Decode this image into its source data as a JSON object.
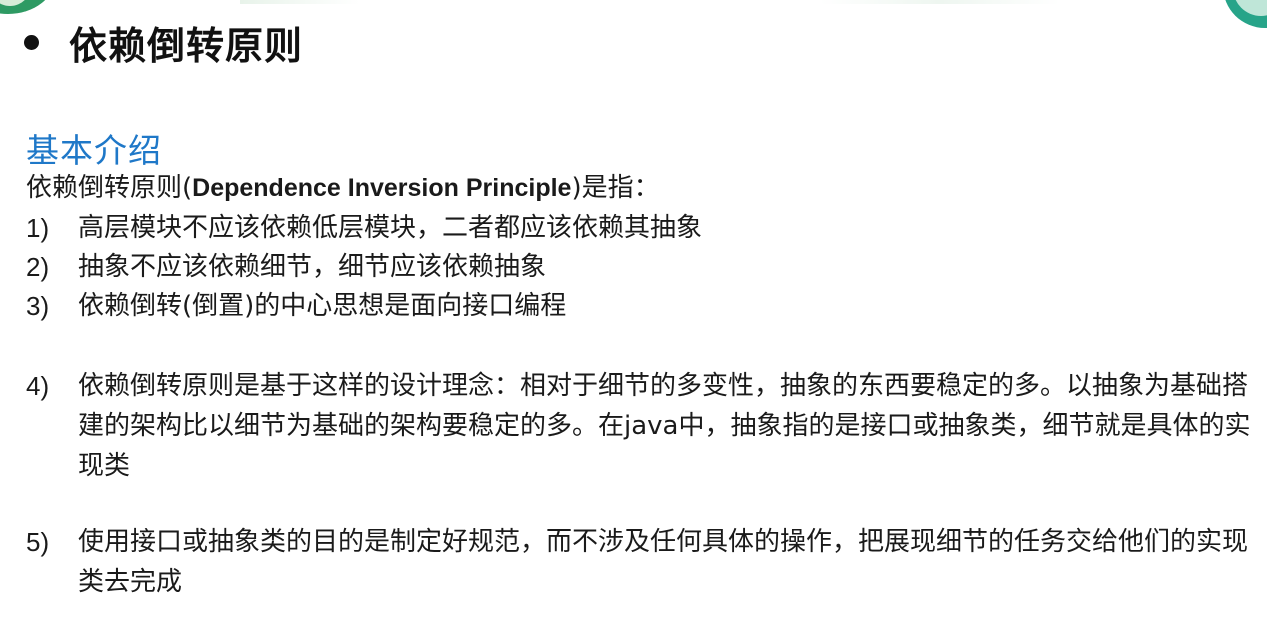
{
  "slide": {
    "title": "依赖倒转原则",
    "section_heading": "基本介绍",
    "intro": {
      "prefix": "依赖倒转原则(",
      "english": "Dependence Inversion Principle",
      "suffix": ")是指："
    },
    "items": [
      {
        "number": "1)",
        "text": "高层模块不应该依赖低层模块，二者都应该依赖其抽象"
      },
      {
        "number": "2)",
        "text": "抽象不应该依赖细节，细节应该依赖抽象"
      },
      {
        "number": "3)",
        "text": "依赖倒转(倒置)的中心思想是面向接口编程"
      },
      {
        "number": "4)",
        "text": "依赖倒转原则是基于这样的设计理念：相对于细节的多变性，抽象的东西要稳定的多。以抽象为基础搭建的架构比以细节为基础的架构要稳定的多。在java中，抽象指的是接口或抽象类，细节就是具体的实现类"
      },
      {
        "number": "5)",
        "text": "使用接口或抽象类的目的是制定好规范，而不涉及任何具体的操作，把展现细节的任务交给他们的实现类去完成"
      }
    ]
  },
  "colors": {
    "heading": "#1f78c8",
    "text": "#1a1a1a",
    "accent_green": "#2e9a63"
  },
  "icons": {
    "title_bullet": "filled-circle-bullet"
  }
}
